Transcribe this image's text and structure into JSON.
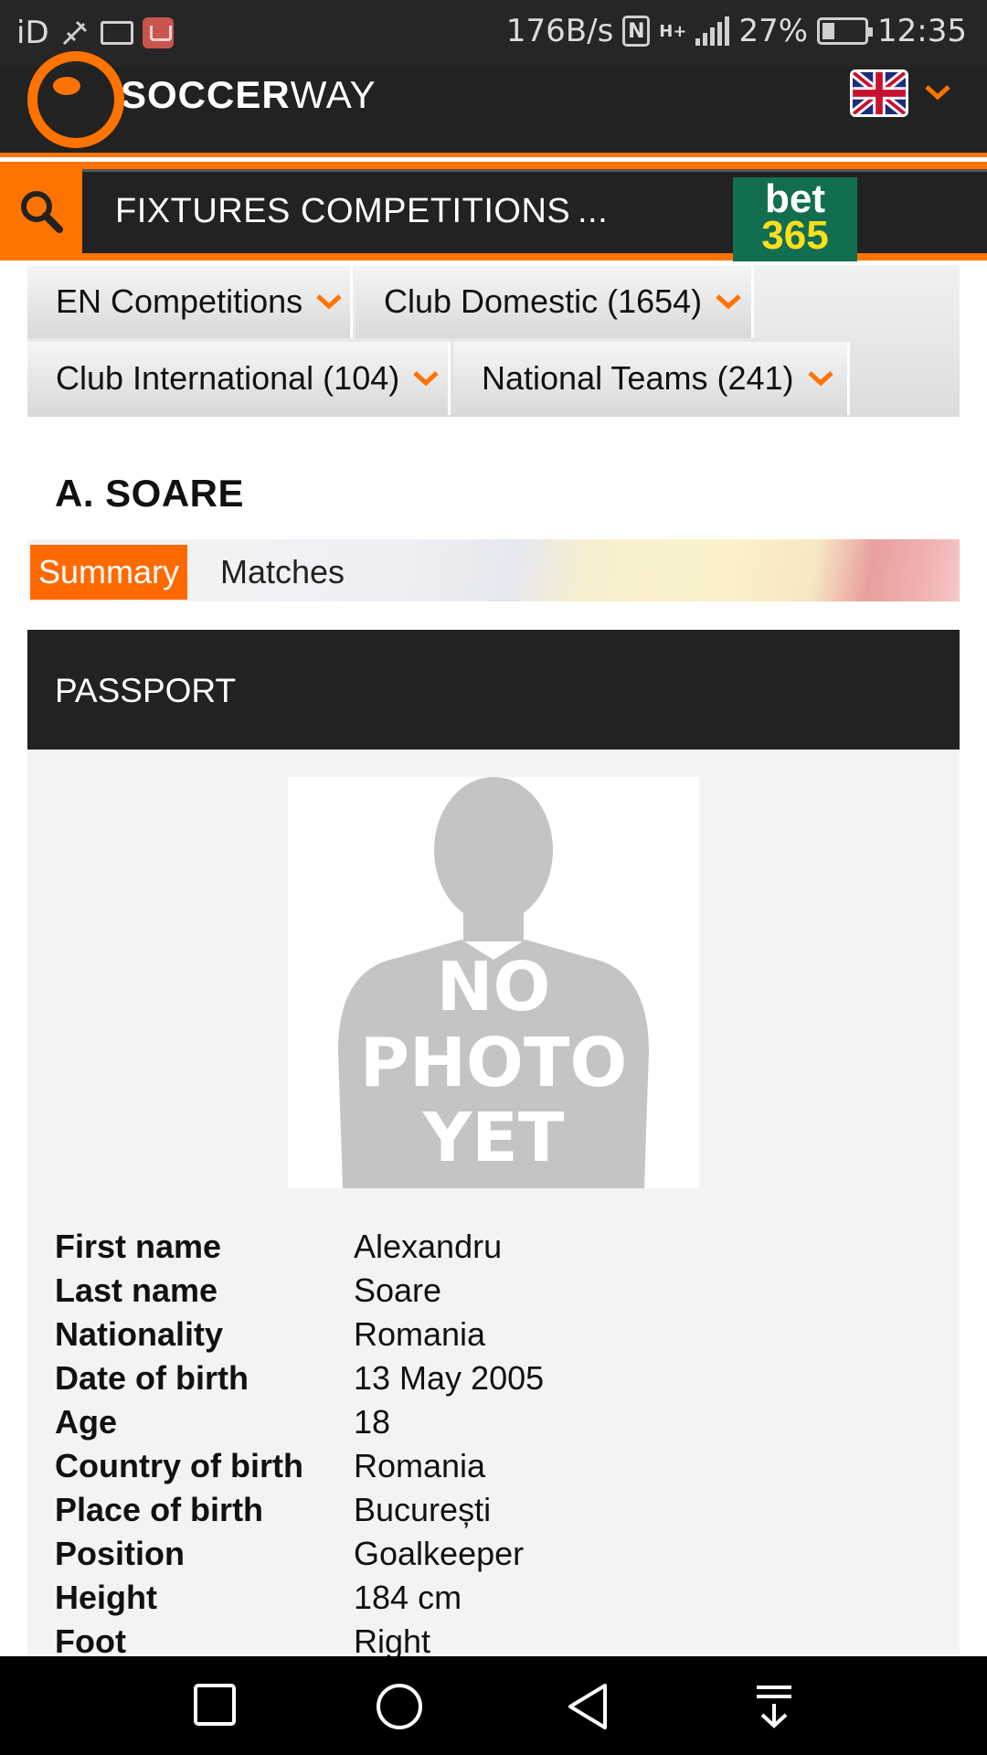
{
  "status_bar": {
    "carrier": "iD",
    "speed": "176B/s",
    "network": "H+",
    "battery": "27%",
    "time": "12:35"
  },
  "header": {
    "logo_bold": "SOCCER",
    "logo_light": "WAY",
    "language_flag": "uk-flag-icon"
  },
  "nav": {
    "items": [
      "FIXTURES",
      "COMPETITIONS",
      "..."
    ],
    "sponsor_top": "bet",
    "sponsor_bottom": "365"
  },
  "competitions": [
    {
      "label": "EN Competitions"
    },
    {
      "label": "Club Domestic (1654)"
    },
    {
      "label": "Club International (104)"
    },
    {
      "label": "National Teams (241)"
    }
  ],
  "player": {
    "name": "A. SOARE"
  },
  "tabs": {
    "summary": "Summary",
    "matches": "Matches"
  },
  "passport": {
    "title": "PASSPORT",
    "photo_placeholder": [
      "NO",
      "PHOTO",
      "YET"
    ],
    "rows": [
      {
        "label": "First name",
        "value": "Alexandru"
      },
      {
        "label": "Last name",
        "value": "Soare"
      },
      {
        "label": "Nationality",
        "value": "Romania"
      },
      {
        "label": "Date of birth",
        "value": "13 May 2005"
      },
      {
        "label": "Age",
        "value": "18"
      },
      {
        "label": "Country of birth",
        "value": "Romania"
      },
      {
        "label": "Place of birth",
        "value": "București"
      },
      {
        "label": "Position",
        "value": "Goalkeeper"
      },
      {
        "label": "Height",
        "value": "184 cm"
      },
      {
        "label": "Foot",
        "value": "Right"
      }
    ]
  },
  "colors": {
    "accent": "#ff7300",
    "header_bg": "#222222",
    "sponsor_green": "#126e51",
    "sponsor_yellow": "#ffdf1b"
  }
}
